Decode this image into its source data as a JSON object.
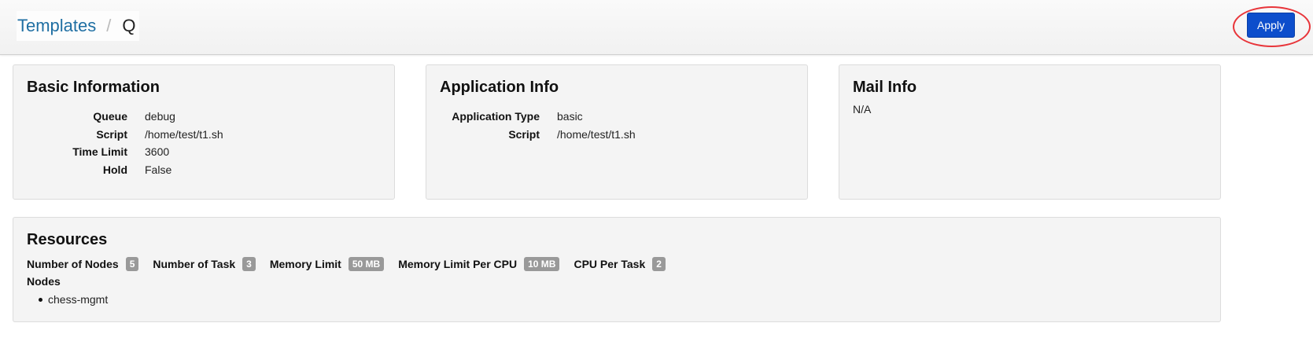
{
  "breadcrumb": {
    "root": "Templates",
    "separator": "/",
    "current": "Q"
  },
  "toolbar": {
    "apply_label": "Apply"
  },
  "basic_info": {
    "title": "Basic Information",
    "rows": [
      {
        "key": "Queue",
        "value": "debug"
      },
      {
        "key": "Script",
        "value": "/home/test/t1.sh"
      },
      {
        "key": "Time Limit",
        "value": "3600"
      },
      {
        "key": "Hold",
        "value": "False"
      }
    ]
  },
  "application_info": {
    "title": "Application Info",
    "rows": [
      {
        "key": "Application Type",
        "value": "basic"
      },
      {
        "key": "Script",
        "value": "/home/test/t1.sh"
      }
    ]
  },
  "mail_info": {
    "title": "Mail Info",
    "value": "N/A"
  },
  "resources": {
    "title": "Resources",
    "items": [
      {
        "label": "Number of Nodes",
        "value": "5"
      },
      {
        "label": "Number of Task",
        "value": "3"
      },
      {
        "label": "Memory Limit",
        "value": "50 MB"
      },
      {
        "label": "Memory Limit Per CPU",
        "value": "10 MB"
      },
      {
        "label": "CPU Per Task",
        "value": "2"
      }
    ],
    "nodes_title": "Nodes",
    "nodes": [
      "chess-mgmt"
    ]
  },
  "colors": {
    "apply_button": "#0d4ecc",
    "highlight_ring": "#e8353a",
    "breadcrumb_link": "#1f6fa3",
    "badge": "#999999"
  }
}
